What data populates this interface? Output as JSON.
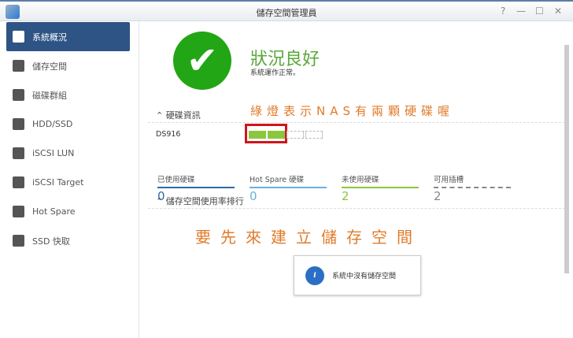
{
  "window": {
    "title": "儲存空間管理員",
    "help": "?",
    "minimize": "—",
    "maximize": "☐",
    "close": "✕"
  },
  "sidebar": {
    "items": [
      {
        "label": "系統概況",
        "icon": "overview-icon"
      },
      {
        "label": "儲存空間",
        "icon": "volume-icon"
      },
      {
        "label": "磁碟群組",
        "icon": "disk-group-icon"
      },
      {
        "label": "HDD/SSD",
        "icon": "hdd-icon"
      },
      {
        "label": "iSCSI LUN",
        "icon": "lun-icon"
      },
      {
        "label": "iSCSI Target",
        "icon": "target-icon"
      },
      {
        "label": "Hot Spare",
        "icon": "hot-spare-icon"
      },
      {
        "label": "SSD 快取",
        "icon": "ssd-cache-icon"
      }
    ]
  },
  "status": {
    "title": "狀況良好",
    "subtitle": "系統運作正常。"
  },
  "disk_info": {
    "header": "硬碟資訊",
    "annotation": "綠燈表示NAS有兩顆硬碟喔",
    "model": "DS916",
    "slots": [
      "used",
      "used",
      "empty",
      "empty"
    ],
    "stats": [
      {
        "label": "已使用硬碟",
        "value": "0",
        "color": "#2e6aa6"
      },
      {
        "label": "Hot Spare 硬碟",
        "value": "0",
        "color": "#6ab0de"
      },
      {
        "label": "未使用硬碟",
        "value": "2",
        "color": "#8cc63f"
      },
      {
        "label": "可用插槽",
        "value": "2",
        "color": "#888888"
      }
    ]
  },
  "usage": {
    "header": "儲存空間使用率排行",
    "annotation": "要先來建立儲存空間",
    "empty_message": "系統中沒有儲存空間"
  }
}
